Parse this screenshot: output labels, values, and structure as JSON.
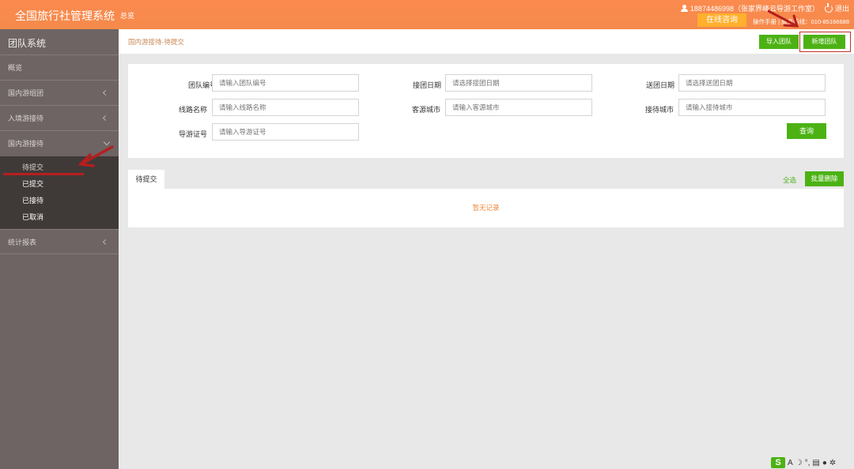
{
  "header": {
    "app_title": "全国旅行社管理系统",
    "overview_link": "总览",
    "user_text": "18874486998（张家界峰云导游工作室）",
    "logout": "退出",
    "consult_button": "在线咨询",
    "sub_links": "操作手册 | 服务热线：010-85166688"
  },
  "sidebar": {
    "title": "团队系统",
    "items": [
      {
        "label": "概览"
      },
      {
        "label": "国内游组团"
      },
      {
        "label": "入境游接待"
      },
      {
        "label": "国内游接待"
      }
    ],
    "sub_items": [
      {
        "label": "待提交"
      },
      {
        "label": "已提交"
      },
      {
        "label": "已接待"
      },
      {
        "label": "已取消"
      }
    ],
    "stats": "统计报表"
  },
  "toolbar": {
    "breadcrumb": "国内游接待-待提交",
    "import_label": "导入团队",
    "add_label": "新增团队"
  },
  "search": {
    "team_no_label": "团队编号",
    "team_no_placeholder": "请输入团队编号",
    "pickup_date_label": "接团日期",
    "pickup_date_placeholder": "请选择接团日期",
    "dropoff_date_label": "送团日期",
    "dropoff_date_placeholder": "请选择送团日期",
    "route_label": "线路名称",
    "route_placeholder": "请输入线路名称",
    "source_city_label": "客源城市",
    "source_city_placeholder": "请输入客源城市",
    "reception_city_label": "接待城市",
    "reception_city_placeholder": "请输入接待城市",
    "guide_no_label": "导游证号",
    "guide_no_placeholder": "请输入导游证号",
    "query_label": "查询"
  },
  "list": {
    "tab_label": "待提交",
    "select_all": "全选",
    "batch_delete": "批量删除",
    "empty_text": "暂无记录"
  },
  "tray": {
    "ime_label": "S",
    "letter": "A"
  },
  "colors": {
    "header_orange": "#f78b4d",
    "sidebar_bg": "#6d6463",
    "accent_green": "#4cb214",
    "annotation_red": "#b41f1f"
  }
}
